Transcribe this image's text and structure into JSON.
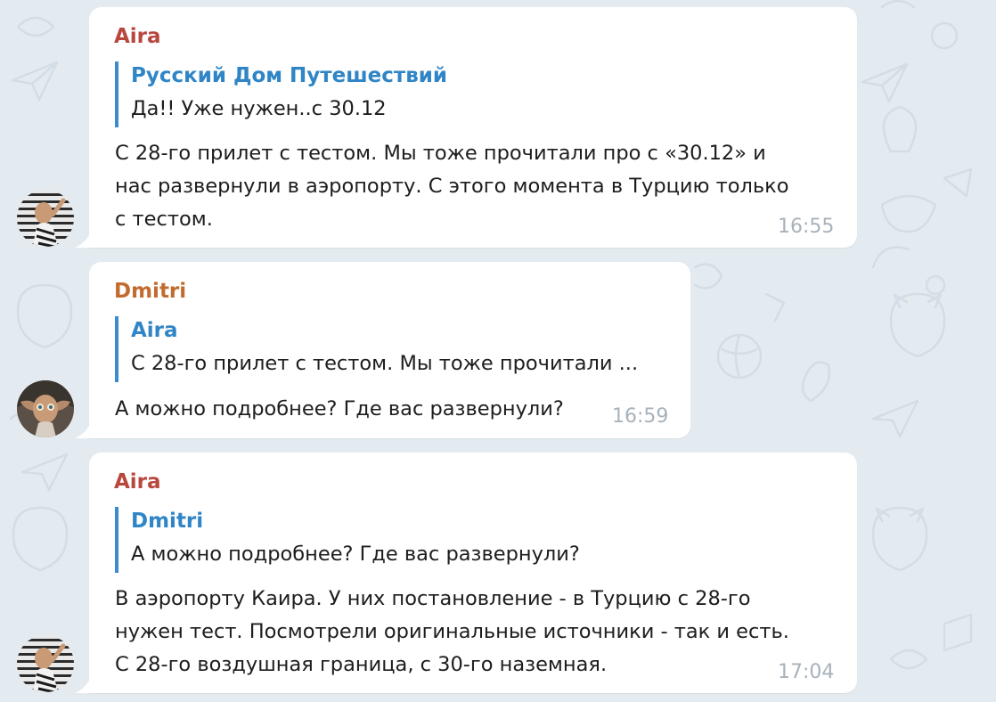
{
  "colors": {
    "background": "#e4ebf0",
    "bubble": "#ffffff",
    "aira_name": "#b8473e",
    "dmitri_name": "#c16b2e",
    "reply_accent": "#3b8ccf",
    "time": "#a8b2bb"
  },
  "messages": [
    {
      "sender": "Aira",
      "avatar_icon": "user-avatar-photo-icon",
      "reply": {
        "name": "Русский Дом Путешествий",
        "text": "Да!! Уже нужен..с 30.12"
      },
      "lines": [
        "С 28-го прилет с тестом. Мы тоже прочитали про с «30.12» и",
        "нас развернули в аэропорту. С этого момента в Турцию только",
        "с тестом."
      ],
      "time": "16:55"
    },
    {
      "sender": "Dmitri",
      "avatar_icon": "user-avatar-photo-icon",
      "reply": {
        "name": "Aira",
        "text": "С 28-го прилет с тестом. Мы тоже прочитали ..."
      },
      "lines": [
        "А можно подробнее? Где вас развернули?"
      ],
      "time": "16:59"
    },
    {
      "sender": "Aira",
      "avatar_icon": "user-avatar-photo-icon",
      "reply": {
        "name": "Dmitri",
        "text": "А можно подробнее? Где вас развернули?"
      },
      "lines": [
        "В аэропорту Каира. У них постановление - в Турцию с 28-го",
        "нужен тест. Посмотрели оригинальные источники - так и есть.",
        "С 28-го воздушная граница, с 30-го наземная."
      ],
      "time": "17:04"
    }
  ]
}
